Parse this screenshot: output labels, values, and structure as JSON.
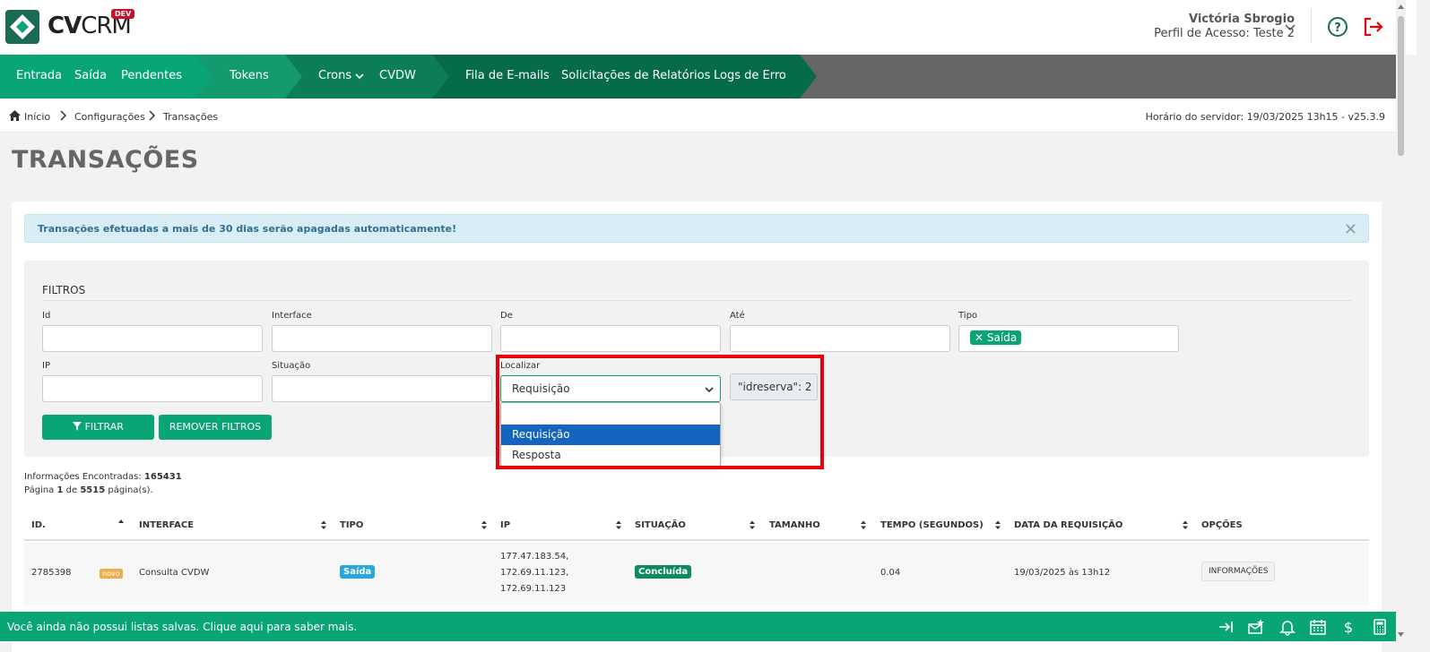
{
  "app": {
    "logo_text": "CV",
    "logo_text2": "CRM",
    "env_badge": "DEV"
  },
  "user": {
    "name": "Victória Sbrogio",
    "profile": "Perfil de Acesso: Teste 2"
  },
  "nav": {
    "items": [
      "Entrada",
      "Saída",
      "Pendentes",
      "Tokens",
      "Crons",
      "CVDW",
      "Fila de E-mails",
      "Solicitações de Relatórios",
      "Logs de Erro"
    ]
  },
  "breadcrumb": {
    "items": [
      "Início",
      "Configurações",
      "Transações"
    ],
    "server_time": "Horário do servidor: 19/03/2025 13h15 - v25.3.9"
  },
  "page": {
    "title": "TRANSAÇÕES"
  },
  "alert": {
    "text": "Transações efetuadas a mais de 30 dias serão apagadas automaticamente!",
    "close": "✕"
  },
  "filters": {
    "title": "FILTROS",
    "labels": {
      "id": "Id",
      "interface": "Interface",
      "de": "De",
      "ate": "Até",
      "tipo": "Tipo",
      "ip": "IP",
      "situacao": "Situação",
      "localizar": "Localizar"
    },
    "tipo_tag": "Saída",
    "localizar_value": "Requisição",
    "json_value": "\"idreserva\": 2",
    "filter_btn": "FILTRAR",
    "remove_btn": "REMOVER FILTROS",
    "dropdown_options": [
      "Requisição",
      "Resposta"
    ],
    "dropdown_selected": "Requisição"
  },
  "summary": {
    "found_label": "Informações Encontradas:",
    "found_count": "165431",
    "page_label": "Página",
    "page": "1",
    "of_label": "de",
    "pages": "5515",
    "pages_suffix": "página(s)."
  },
  "table": {
    "headers": [
      "ID.",
      "INTERFACE",
      "TIPO",
      "IP",
      "SITUAÇÃO",
      "TAMANHO",
      "TEMPO (SEGUNDOS)",
      "DATA DA REQUISIÇÃO",
      "OPÇÕES"
    ],
    "rows": [
      {
        "id": "2785398",
        "novo": "novo",
        "interface": "Consulta CVDW",
        "tipo": "Saída",
        "ip": [
          "177.47.183.54,",
          "172.69.11.123,",
          "172.69.11.123"
        ],
        "situacao": "Concluída",
        "tamanho": "",
        "tempo": "0.04",
        "data": "19/03/2025 às 13h12",
        "opcoes": "INFORMAÇÕES"
      }
    ]
  },
  "footer": {
    "text": "Você ainda não possui listas salvas. Clique aqui para saber mais."
  },
  "colors": {
    "brand": "#0aa575",
    "nav_gray": "#666666",
    "highlight": "#e8000b"
  }
}
